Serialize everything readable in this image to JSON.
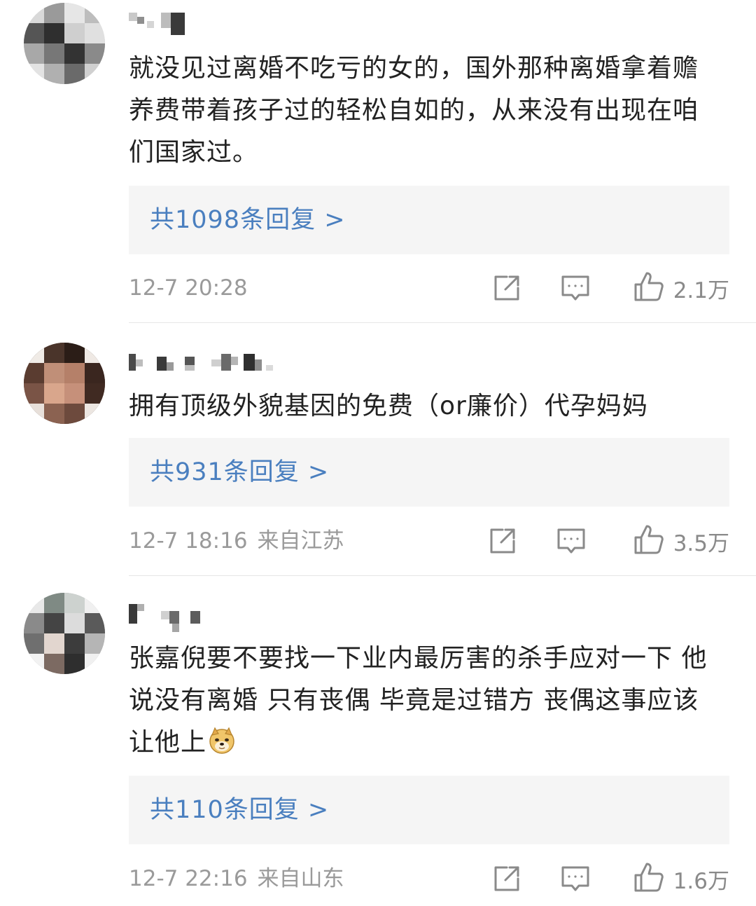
{
  "comments": [
    {
      "text": "就没见过离婚不吃亏的女的，国外那种离婚拿着赡养费带着孩子过的轻松自如的，从来没有出现在咱们国家过。",
      "replies_label": "共1098条回复 >",
      "time": "12-7 20:28",
      "location": "",
      "likes": "2.1万"
    },
    {
      "text": "拥有顶级外貌基因的免费（or廉价）代孕妈妈",
      "replies_label": "共931条回复 >",
      "time": "12-7 18:16",
      "location": "来自江苏",
      "likes": "3.5万"
    },
    {
      "text": "张嘉倪要不要找一下业内最厉害的杀手应对一下 他说没有离婚 只有丧偶 毕竟是过错方 丧偶这事应该让他上",
      "emoji": "doge-emoji",
      "replies_label": "共110条回复 >",
      "time": "12-7 22:16",
      "location": "来自山东",
      "likes": "1.6万"
    }
  ],
  "icons": {
    "share": "share-icon",
    "comment": "comment-icon",
    "like": "thumbs-up-icon"
  },
  "colors": {
    "reply_link": "#4a7fbf",
    "meta_text": "#9a9a9a",
    "reply_box_bg": "#f5f5f5",
    "icon_gray": "#8a8a8a"
  }
}
